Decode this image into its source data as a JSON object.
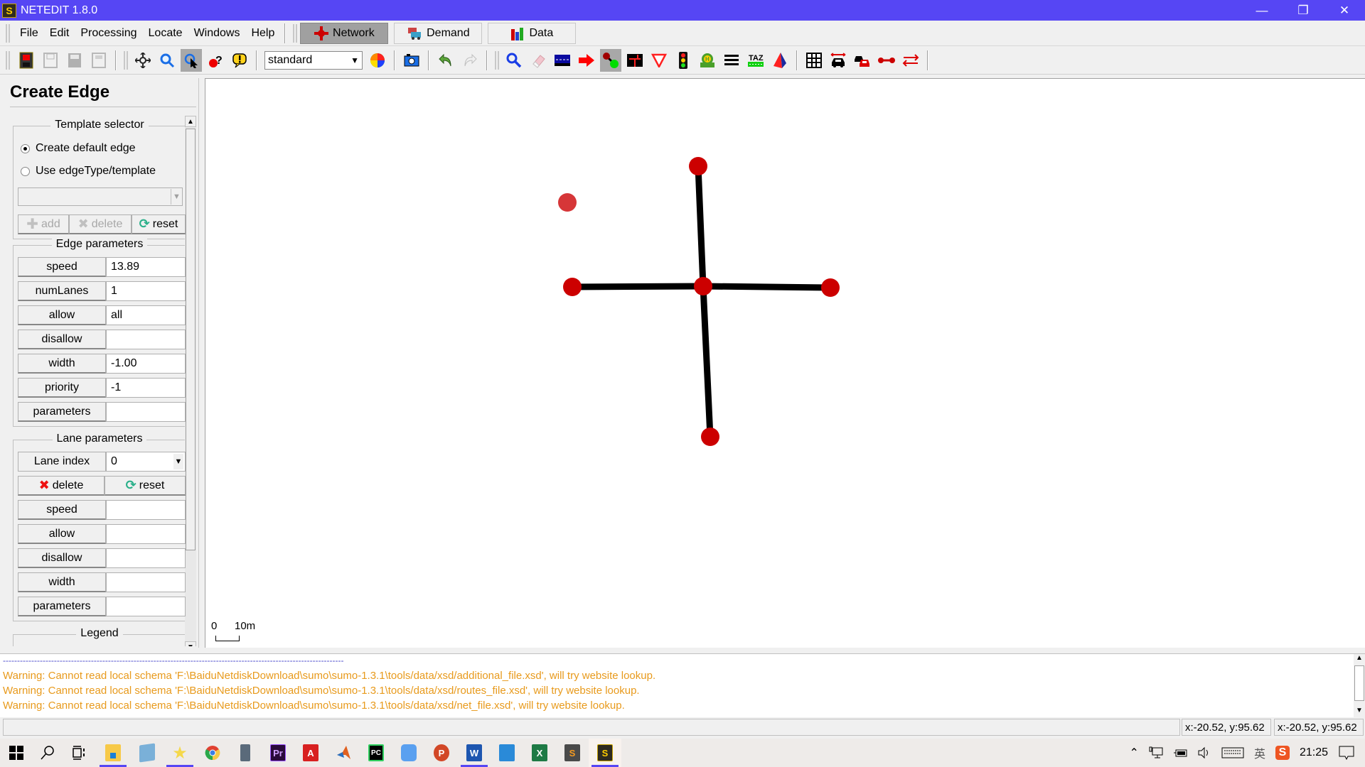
{
  "window": {
    "title": "NETEDIT 1.8.0",
    "app_icon": "netedit-logo-icon",
    "controls": [
      "minimize",
      "restore",
      "close"
    ]
  },
  "menubar": {
    "items": [
      {
        "label": "File",
        "accel": "F"
      },
      {
        "label": "Edit",
        "accel": "E"
      },
      {
        "label": "Processing",
        "accel": "P"
      },
      {
        "label": "Locate",
        "accel": "L"
      },
      {
        "label": "Windows",
        "accel": "W"
      },
      {
        "label": "Help",
        "accel": "H"
      }
    ],
    "supermodes": [
      {
        "label": "Network",
        "icon": "network-icon",
        "active": true
      },
      {
        "label": "Demand",
        "icon": "demand-icon",
        "active": false
      },
      {
        "label": "Data",
        "icon": "data-icon",
        "active": false
      }
    ]
  },
  "toolbar": {
    "file_buttons": [
      "new-network",
      "save-network",
      "save-as",
      "save-all"
    ],
    "navigation_buttons": [
      {
        "name": "recenter-view",
        "pressed": false
      },
      {
        "name": "zoom-view",
        "pressed": false
      },
      {
        "name": "locate",
        "pressed": true
      },
      {
        "name": "inspect-help",
        "pressed": false
      },
      {
        "name": "tooltip",
        "pressed": false
      }
    ],
    "scheme_combo": {
      "value": "standard"
    },
    "edit_modes": [
      {
        "name": "inspect",
        "pressed": false
      },
      {
        "name": "delete",
        "pressed": false
      },
      {
        "name": "select",
        "pressed": false
      },
      {
        "name": "move",
        "pressed": false
      },
      {
        "name": "create-edge",
        "pressed": true
      },
      {
        "name": "connections",
        "pressed": false
      },
      {
        "name": "prohibitions",
        "pressed": false
      },
      {
        "name": "traffic-lights",
        "pressed": false
      },
      {
        "name": "additionals",
        "pressed": false
      },
      {
        "name": "crossings",
        "pressed": false
      },
      {
        "name": "taz",
        "pressed": false
      },
      {
        "name": "polygons",
        "pressed": false
      }
    ],
    "view_toggles": [
      "grid",
      "vehicle-spread",
      "vehicle-merge",
      "chain-edges",
      "two-way-edges"
    ]
  },
  "sidebar": {
    "frame_title": "Create Edge",
    "template_selector": {
      "title": "Template selector",
      "options": [
        {
          "label": "Create default edge",
          "selected": true
        },
        {
          "label": "Use edgeType/template",
          "selected": false
        }
      ],
      "combo_value": "",
      "buttons": [
        {
          "label": "add",
          "enabled": false
        },
        {
          "label": "delete",
          "enabled": false
        },
        {
          "label": "reset",
          "enabled": true
        }
      ]
    },
    "edge_parameters": {
      "title": "Edge parameters",
      "rows": [
        {
          "label": "speed",
          "value": "13.89"
        },
        {
          "label": "numLanes",
          "value": "1"
        },
        {
          "label": "allow",
          "value": "all"
        },
        {
          "label": "disallow",
          "value": ""
        },
        {
          "label": "width",
          "value": "-1.00"
        },
        {
          "label": "priority",
          "value": "-1"
        },
        {
          "label": "parameters",
          "value": ""
        }
      ]
    },
    "lane_parameters": {
      "title": "Lane parameters",
      "lane_index_label": "Lane index",
      "lane_index_value": "0",
      "delete_label": "delete",
      "reset_label": "reset",
      "rows": [
        {
          "label": "speed",
          "value": ""
        },
        {
          "label": "allow",
          "value": ""
        },
        {
          "label": "disallow",
          "value": ""
        },
        {
          "label": "width",
          "value": ""
        },
        {
          "label": "parameters",
          "value": ""
        }
      ]
    },
    "legend": {
      "title": "Legend"
    }
  },
  "canvas": {
    "scale_bar": {
      "start": "0",
      "end": "10m"
    },
    "junction_color": "#cc0000",
    "edge_color": "#000000"
  },
  "console": {
    "separator": "------------------------------------------------------------------------------------------------------------------------",
    "lines": [
      "Warning: Cannot read local schema 'F:\\BaiduNetdiskDownload\\sumo\\sumo-1.3.1\\tools/data/xsd/additional_file.xsd', will try website lookup.",
      "Warning: Cannot read local schema 'F:\\BaiduNetdiskDownload\\sumo\\sumo-1.3.1\\tools/data/xsd/routes_file.xsd', will try website lookup.",
      "Warning: Cannot read local schema 'F:\\BaiduNetdiskDownload\\sumo\\sumo-1.3.1\\tools/data/xsd/net_file.xsd', will try website lookup."
    ],
    "warning_color": "#e89a1c"
  },
  "statusbar": {
    "coord_1": "x:-20.52, y:95.62",
    "coord_2": "x:-20.52, y:95.62"
  },
  "taskbar": {
    "apps": [
      {
        "name": "start",
        "label": ""
      },
      {
        "name": "search",
        "label": ""
      },
      {
        "name": "task-view",
        "label": ""
      },
      {
        "name": "file-explorer",
        "label": "",
        "running": true
      },
      {
        "name": "notepad",
        "label": ""
      },
      {
        "name": "sticky-star",
        "label": "",
        "running": true
      },
      {
        "name": "chrome",
        "label": ""
      },
      {
        "name": "calculator",
        "label": ""
      },
      {
        "name": "premiere",
        "label": "Pr"
      },
      {
        "name": "autocad",
        "label": "A"
      },
      {
        "name": "matlab",
        "label": ""
      },
      {
        "name": "pycharm",
        "label": "PC"
      },
      {
        "name": "feishu",
        "label": ""
      },
      {
        "name": "powerpoint",
        "label": "P"
      },
      {
        "name": "word",
        "label": "W",
        "running": true
      },
      {
        "name": "visio",
        "label": ""
      },
      {
        "name": "excel",
        "label": "X"
      },
      {
        "name": "sublime",
        "label": "S"
      },
      {
        "name": "netedit",
        "label": "",
        "running": true,
        "active": true
      }
    ],
    "tray": {
      "time": "21:25",
      "icons": [
        "chevron-up",
        "network",
        "battery",
        "volume",
        "keyboard",
        "ime",
        "sogou"
      ]
    }
  }
}
